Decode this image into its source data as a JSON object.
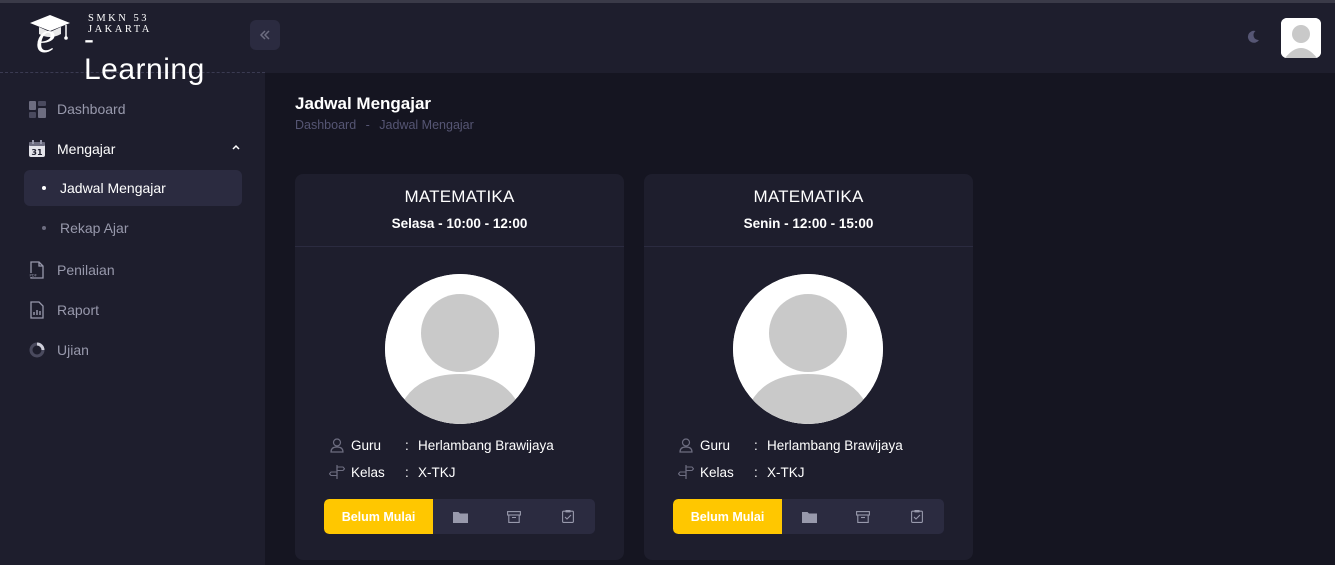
{
  "brand": {
    "school": "SMKN 53 JAKARTA",
    "e": "e",
    "learning": "-Learning"
  },
  "sidebar": {
    "items": [
      {
        "label": "Dashboard",
        "icon": "dashboard-icon"
      },
      {
        "label": "Mengajar",
        "icon": "calendar-icon",
        "calendar_day": "31",
        "open": true
      },
      {
        "label": "Penilaian",
        "icon": "pdf-file-icon"
      },
      {
        "label": "Raport",
        "icon": "report-file-icon"
      },
      {
        "label": "Ujian",
        "icon": "progress-circle-icon"
      }
    ],
    "subitems": [
      {
        "label": "Jadwal Mengajar",
        "active": true
      },
      {
        "label": "Rekap Ajar",
        "active": false
      }
    ]
  },
  "header": {
    "theme_icon": "moon-icon",
    "avatar_icon": "user-avatar"
  },
  "page": {
    "title": "Jadwal Mengajar",
    "breadcrumb": [
      "Dashboard",
      "-",
      "Jadwal Mengajar"
    ]
  },
  "cards": [
    {
      "subject": "MATEMATIKA",
      "time": "Selasa - 10:00 - 12:00",
      "guru_label": "Guru",
      "guru": "Herlambang Brawijaya",
      "kelas_label": "Kelas",
      "kelas": "X-TKJ",
      "colon": ":",
      "status": "Belum Mulai"
    },
    {
      "subject": "MATEMATIKA",
      "time": "Senin - 12:00 - 15:00",
      "guru_label": "Guru",
      "guru": "Herlambang Brawijaya",
      "kelas_label": "Kelas",
      "kelas": "X-TKJ",
      "colon": ":",
      "status": "Belum Mulai"
    }
  ],
  "colors": {
    "background": "#151521",
    "panel": "#1e1e2d",
    "accent": "#ffc700",
    "muted": "#9899ac"
  }
}
